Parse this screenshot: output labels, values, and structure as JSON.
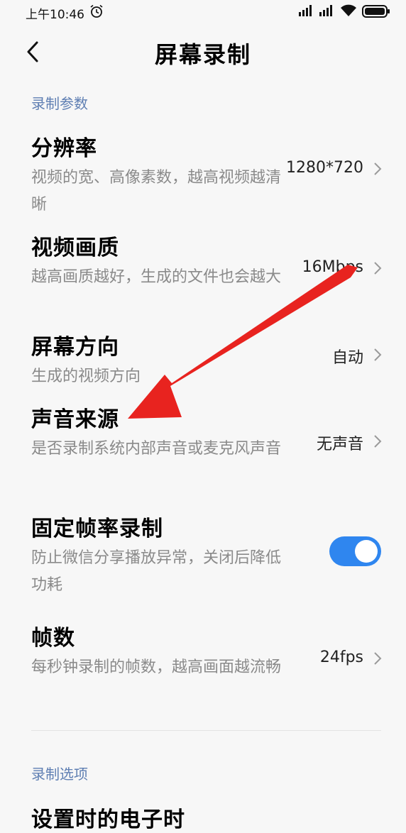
{
  "status_bar": {
    "time": "上午10:46",
    "icons": [
      "alarm-icon",
      "signal-icon",
      "signal-icon",
      "wifi-icon",
      "battery-icon"
    ]
  },
  "header": {
    "back_icon": "chevron-left-icon",
    "title": "屏幕录制"
  },
  "sections": [
    {
      "title": "录制参数",
      "rows": [
        {
          "title": "分辨率",
          "desc": "视频的宽、高像素数，越高视频越清晰",
          "value": "1280*720"
        },
        {
          "title": "视频画质",
          "desc": "越高画质越好，生成的文件也会越大",
          "value": "16Mbps"
        },
        {
          "title": "屏幕方向",
          "desc": "生成的视频方向",
          "value": "自动"
        },
        {
          "title": "声音来源",
          "desc": "是否录制系统内部声音或麦克风声音",
          "value": "无声音"
        },
        {
          "title": "固定帧率录制",
          "desc": "防止微信分享播放异常，关闭后降低功耗",
          "toggle_on": true
        },
        {
          "title": "帧数",
          "desc": "每秒钟录制的帧数，越高画面越流畅",
          "value": "24fps"
        }
      ]
    },
    {
      "title": "录制选项",
      "rows": [
        {
          "title": "设置时的电子时"
        }
      ]
    }
  ],
  "colors": {
    "section_title": "#5f7fb3",
    "toggle_on": "#2f86ef",
    "annotation_arrow": "#e8231f",
    "secondary_text": "#8a8a8a"
  }
}
